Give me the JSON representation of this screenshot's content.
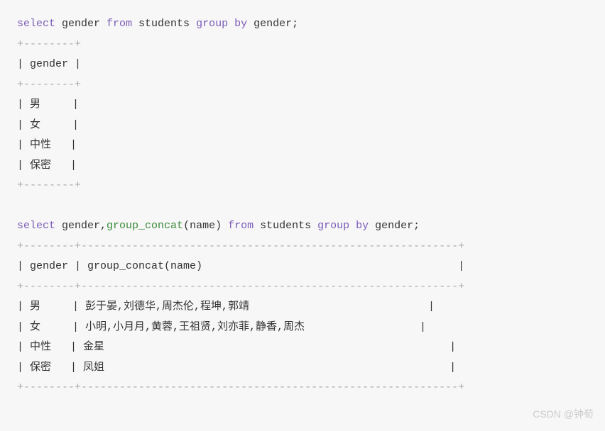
{
  "query1": {
    "select": "select",
    "gender": " gender ",
    "from": "from",
    "students": " students ",
    "group": "group",
    "by": " by",
    "gender2": " gender;",
    "sep1": "+--------+",
    "header": "| gender |",
    "sep2": "+--------+",
    "row1": "| 男     |",
    "row2": "| 女     |",
    "row3": "| 中性   |",
    "row4": "| 保密   |",
    "sep3": "+--------+"
  },
  "query2": {
    "select": "select",
    "gender": " gender,",
    "fn": "group_concat",
    "args": "(name) ",
    "from": "from",
    "students": " students ",
    "group": "group",
    "by": " by",
    "gender2": " gender;",
    "sep1": "+--------+-----------------------------------------------------------+",
    "header": "| gender | group_concat(name)                                        |",
    "sep2": "+--------+-----------------------------------------------------------+",
    "row1": "| 男     | 彭于晏,刘德华,周杰伦,程坤,郭靖                            |",
    "row2": "| 女     | 小明,小月月,黄蓉,王祖贤,刘亦菲,静香,周杰                  |",
    "row3": "| 中性   | 金星                                                      |",
    "row4": "| 保密   | 凤姐                                                      |",
    "sep3": "+--------+-----------------------------------------------------------+"
  },
  "watermark": "CSDN @钟荀"
}
